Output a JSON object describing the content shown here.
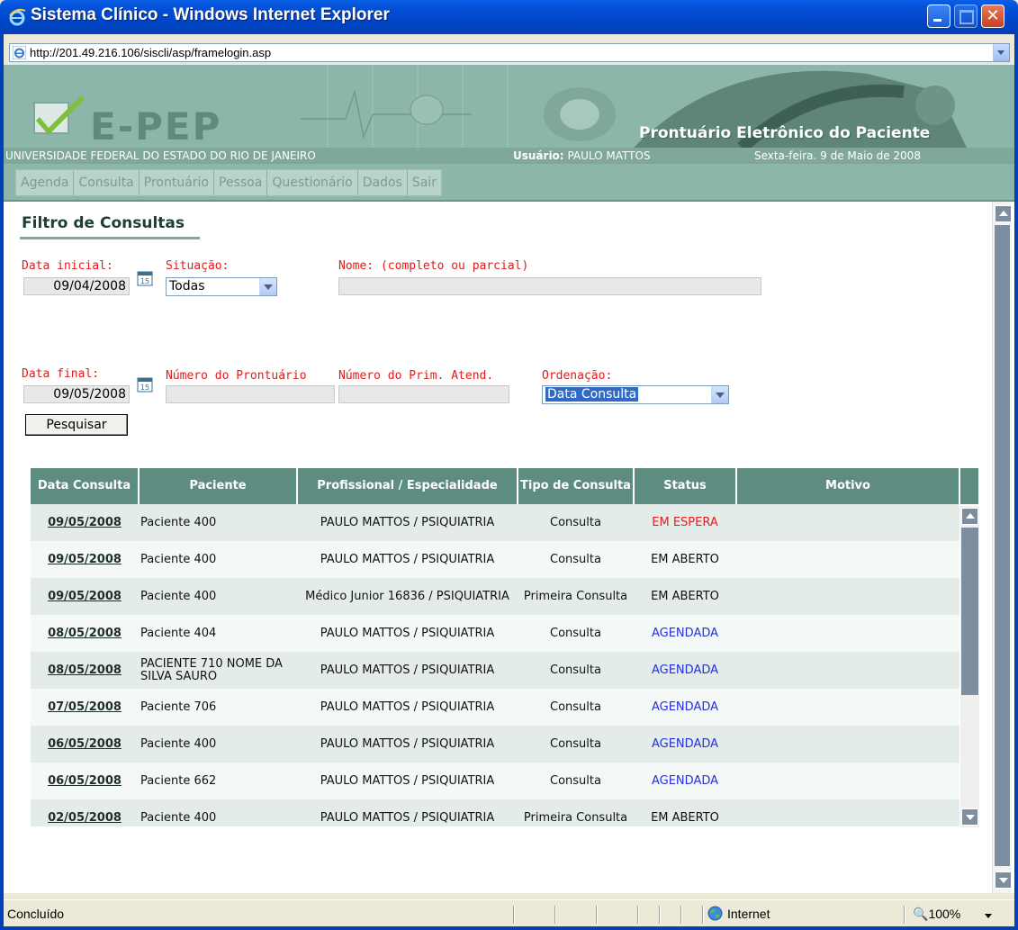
{
  "window": {
    "title": "Sistema Clínico - Windows Internet Explorer",
    "close_glyph": "✕"
  },
  "address": {
    "url": "http://201.49.216.106/siscli/asp/framelogin.asp"
  },
  "banner": {
    "logo": "E-PEP",
    "subtitle": "Prontuário Eletrônico do Paciente",
    "university": "UNIVERSIDADE FEDERAL DO ESTADO DO RIO DE JANEIRO",
    "user_label": "Usuário:",
    "user_name": "PAULO MATTOS",
    "date": "Sexta-feira. 9 de Maio de 2008"
  },
  "nav": {
    "items": [
      "Agenda",
      "Consulta",
      "Prontuário",
      "Pessoa",
      "Questionário",
      "Dados",
      "Sair"
    ]
  },
  "filter": {
    "title": "Filtro de Consultas",
    "data_inicial_label": "Data inicial:",
    "data_inicial_value": "09/04/2008",
    "situacao_label": "Situação:",
    "situacao_value": "Todas",
    "nome_label": "Nome: (completo ou parcial)",
    "nome_value": "",
    "data_final_label": "Data final:",
    "data_final_value": "09/05/2008",
    "prontuario_label": "Número do Prontuário",
    "prontuario_value": "",
    "prim_atend_label": "Número do Prim. Atend.",
    "prim_atend_value": "",
    "ordenacao_label": "Ordenação:",
    "ordenacao_value": "Data Consulta",
    "search_button": "Pesquisar"
  },
  "table": {
    "headers": [
      "Data Consulta",
      "Paciente",
      "Profissional / Especialidade",
      "Tipo de Consulta",
      "Status",
      "Motivo"
    ],
    "rows": [
      {
        "date": "09/05/2008",
        "patient": "Paciente 400",
        "prof": "PAULO MATTOS / PSIQUIATRIA",
        "tipo": "Consulta",
        "status": "EM ESPERA",
        "motivo": ""
      },
      {
        "date": "09/05/2008",
        "patient": "Paciente 400",
        "prof": "PAULO MATTOS / PSIQUIATRIA",
        "tipo": "Consulta",
        "status": "EM ABERTO",
        "motivo": ""
      },
      {
        "date": "09/05/2008",
        "patient": "Paciente 400",
        "prof": "Médico Junior 16836 / PSIQUIATRIA",
        "tipo": "Primeira Consulta",
        "status": "EM ABERTO",
        "motivo": ""
      },
      {
        "date": "08/05/2008",
        "patient": "Paciente 404",
        "prof": "PAULO MATTOS / PSIQUIATRIA",
        "tipo": "Consulta",
        "status": "AGENDADA",
        "motivo": ""
      },
      {
        "date": "08/05/2008",
        "patient": "PACIENTE 710 NOME DA SILVA SAURO",
        "prof": "PAULO MATTOS / PSIQUIATRIA",
        "tipo": "Consulta",
        "status": "AGENDADA",
        "motivo": ""
      },
      {
        "date": "07/05/2008",
        "patient": "Paciente 706",
        "prof": "PAULO MATTOS / PSIQUIATRIA",
        "tipo": "Consulta",
        "status": "AGENDADA",
        "motivo": ""
      },
      {
        "date": "06/05/2008",
        "patient": "Paciente 400",
        "prof": "PAULO MATTOS / PSIQUIATRIA",
        "tipo": "Consulta",
        "status": "AGENDADA",
        "motivo": ""
      },
      {
        "date": "06/05/2008",
        "patient": "Paciente 662",
        "prof": "PAULO MATTOS / PSIQUIATRIA",
        "tipo": "Consulta",
        "status": "AGENDADA",
        "motivo": ""
      },
      {
        "date": "02/05/2008",
        "patient": "Paciente 400",
        "prof": "PAULO MATTOS / PSIQUIATRIA",
        "tipo": "Primeira Consulta",
        "status": "EM ABERTO",
        "motivo": ""
      }
    ]
  },
  "statusbar": {
    "text": "Concluído",
    "zone": "Internet",
    "zoom": "100%"
  },
  "colors": {
    "accent_green": "#5E8C80",
    "status_red": "#E21E1E",
    "status_blue": "#2530E0",
    "label_red": "#DD1C1C"
  }
}
